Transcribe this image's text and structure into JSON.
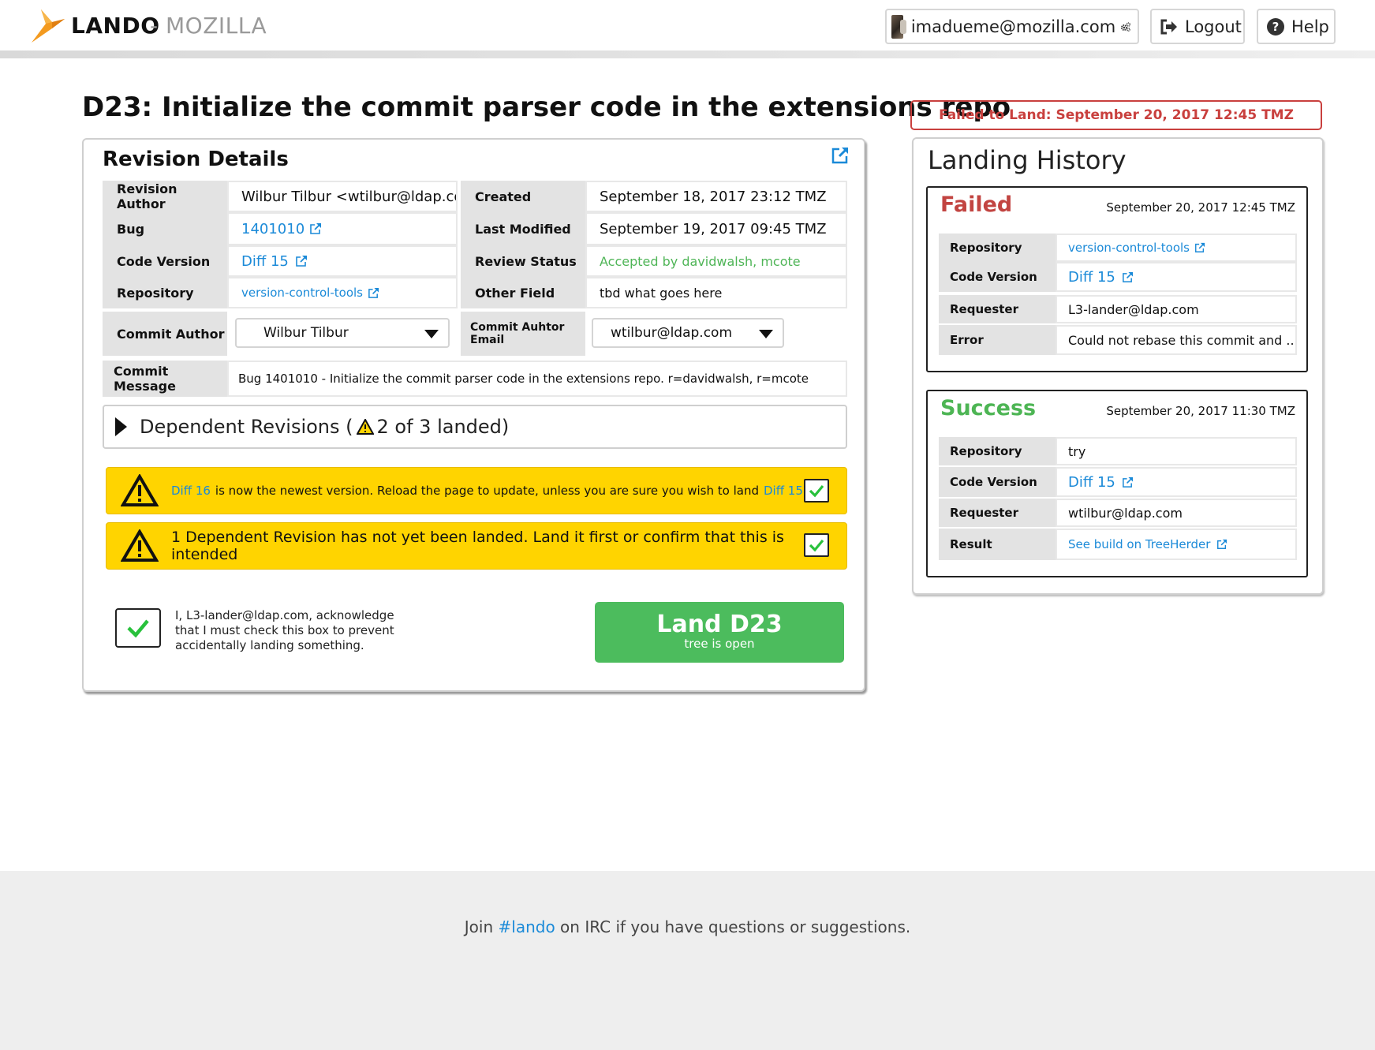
{
  "header": {
    "brand": "LANDO",
    "brand_sub": "- MOZILLA",
    "user_email": "imadueme@mozilla.com",
    "logout_label": "Logout",
    "help_label": "Help"
  },
  "page_title": "D23: Initialize the commit parser code in the extensions repo",
  "revision": {
    "card_title": "Revision Details",
    "left_rows": [
      {
        "label": "Revision Author",
        "value": "Wilbur Tilbur <wtilbur@ldap.com>"
      },
      {
        "label": "Bug",
        "value": "1401010"
      },
      {
        "label": "Code Version",
        "value": "Diff 15"
      },
      {
        "label": "Repository",
        "value": "version-control-tools"
      }
    ],
    "right_rows": [
      {
        "label": "Created",
        "value": "September 18, 2017 23:12 TMZ"
      },
      {
        "label": "Last Modified",
        "value": "September 19, 2017 09:45 TMZ"
      },
      {
        "label": "Review Status",
        "value": "Accepted by davidwalsh, mcote"
      },
      {
        "label": "Other Field",
        "value": "tbd what goes here"
      }
    ],
    "commit_author_label": "Commit Author",
    "commit_author_value": "Wilbur Tilbur",
    "commit_email_label": "Commit Auhtor Email",
    "commit_email_value": "wtilbur@ldap.com",
    "commit_message_label": "Commit Message",
    "commit_message_value": "Bug 1401010 - Initialize the commit parser code in the extensions repo. r=davidwalsh, r=mcote"
  },
  "dependent": {
    "label_prefix": "Dependent Revisions (",
    "label_count": "2 of 3 landed)"
  },
  "warnings": {
    "w1_link1": "Diff 16",
    "w1_text": "is now the newest version. Reload the page to update, unless you are sure you wish to land",
    "w1_link2": "Diff 15",
    "w2_text": "1 Dependent Revision has not yet been landed. Land it first or confirm that this is intended"
  },
  "acknowledge_text": "I, L3-lander@ldap.com, acknowledge that I must check this box to prevent accidentally landing something.",
  "land_button": {
    "title": "Land D23",
    "subtitle": "tree is open"
  },
  "failed_banner": "Failed to Land: September 20, 2017 12:45 TMZ",
  "history": {
    "title": "Landing History",
    "entries": [
      {
        "status": "Failed",
        "status_color": "#c24441",
        "date": "September 20, 2017 12:45 TMZ",
        "rows": [
          {
            "label": "Repository",
            "value": "version-control-tools"
          },
          {
            "label": "Code Version",
            "value": "Diff 15"
          },
          {
            "label": "Requester",
            "value": "L3-lander@ldap.com"
          },
          {
            "label": "Error",
            "value": "Could not rebase this commit and ..."
          }
        ]
      },
      {
        "status": "Success",
        "status_color": "#4db554",
        "date": "September 20, 2017 11:30 TMZ",
        "rows": [
          {
            "label": "Repository",
            "value": "try"
          },
          {
            "label": "Code Version",
            "value": "Diff 15"
          },
          {
            "label": "Requester",
            "value": "wtilbur@ldap.com"
          },
          {
            "label": "Result",
            "value": "See build on TreeHerder"
          }
        ]
      }
    ]
  },
  "footer": {
    "prefix": "Join",
    "link": "#lando",
    "suffix": "on IRC if you have questions or suggestions."
  },
  "colors": {
    "accent_link": "#1b8ad8",
    "land_green": "#4cbc5d",
    "warning_yellow": "#ffd400",
    "error_red": "#c9403e"
  }
}
